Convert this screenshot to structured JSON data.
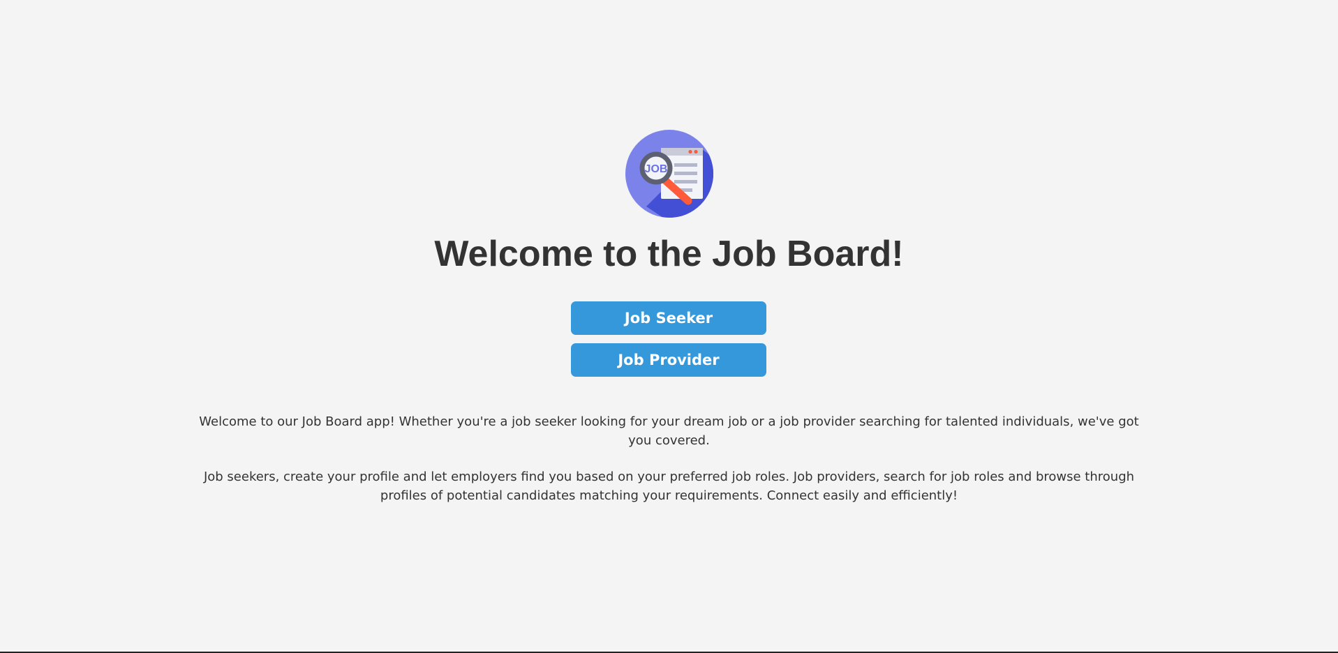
{
  "header": {
    "logo": {
      "icon": "job-search-logo-icon",
      "text": "JOB",
      "colors": {
        "circle_light": "#7b83eb",
        "circle_dark": "#4350d6",
        "magnifier": "#5c6070",
        "handle": "#ff5b3a"
      }
    },
    "title": "Welcome to the Job Board!"
  },
  "actions": {
    "job_seeker_label": "Job Seeker",
    "job_provider_label": "Job Provider",
    "button_color": "#3498db"
  },
  "description": {
    "paragraph_1": "Welcome to our Job Board app! Whether you're a job seeker looking for your dream job or a job provider searching for talented individuals, we've got you covered.",
    "paragraph_2": "Job seekers, create your profile and let employers find you based on your preferred job roles. Job providers, search for job roles and browse through profiles of potential candidates matching your requirements. Connect easily and efficiently!"
  }
}
